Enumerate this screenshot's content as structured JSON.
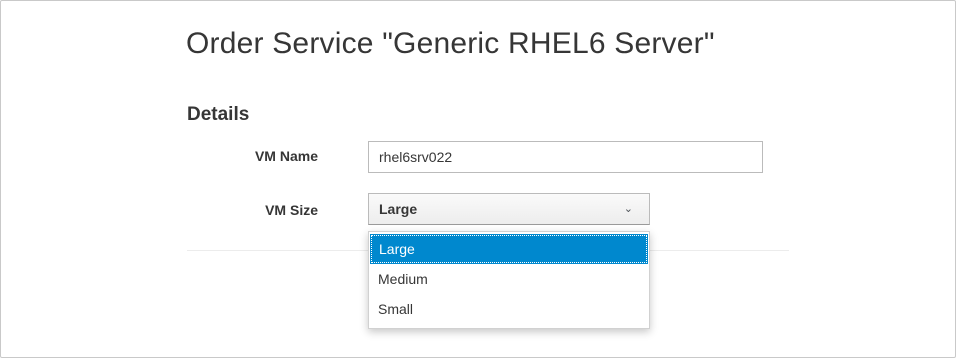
{
  "header": {
    "title": "Order Service \"Generic RHEL6 Server\""
  },
  "details": {
    "heading": "Details",
    "vm_name": {
      "label": "VM Name",
      "value": "rhel6srv022"
    },
    "vm_size": {
      "label": "VM Size",
      "selected": "Large",
      "options": [
        "Large",
        "Medium",
        "Small"
      ]
    }
  },
  "colors": {
    "selection": "#0088ce"
  },
  "icons": {
    "dropdown": "chevron-down-icon"
  }
}
